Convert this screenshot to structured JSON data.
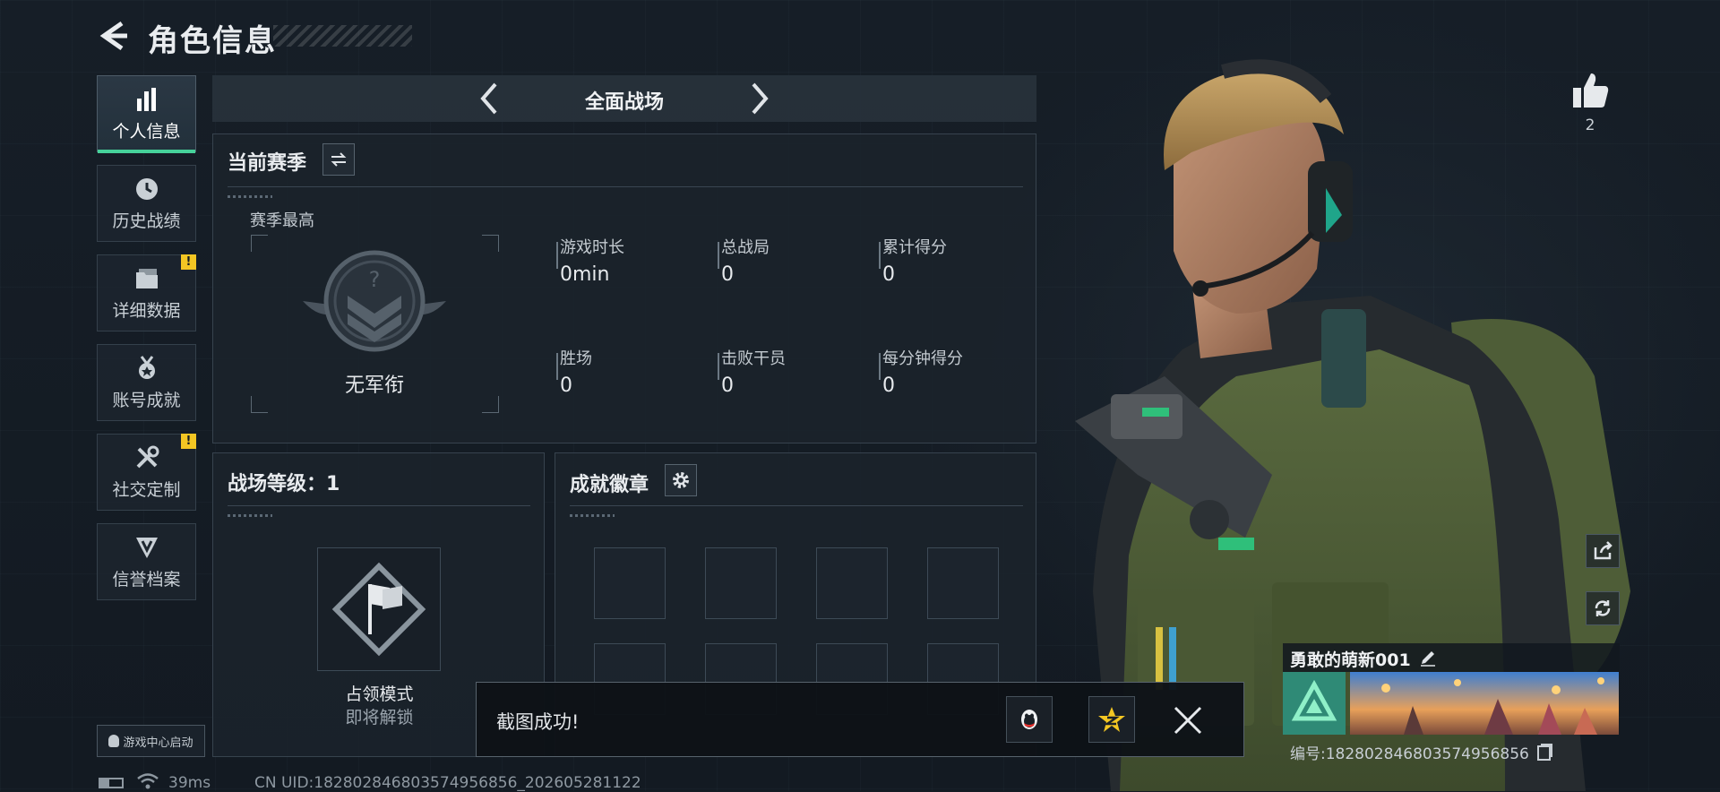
{
  "header": {
    "title": "角色信息"
  },
  "sidebar": {
    "items": [
      {
        "label": "个人信息",
        "icon": "bar-chart-icon",
        "active": true,
        "alert": false
      },
      {
        "label": "历史战绩",
        "icon": "clock-icon",
        "active": false,
        "alert": false
      },
      {
        "label": "详细数据",
        "icon": "folder-icon",
        "active": false,
        "alert": true
      },
      {
        "label": "账号成就",
        "icon": "medal-icon",
        "active": false,
        "alert": false
      },
      {
        "label": "社交定制",
        "icon": "tools-icon",
        "active": false,
        "alert": true
      },
      {
        "label": "信誉档案",
        "icon": "shield-icon",
        "active": false,
        "alert": false
      }
    ],
    "alert_mark": "!",
    "game_center": "游戏中心启动"
  },
  "mode": {
    "label": "全面战场"
  },
  "season": {
    "title": "当前赛季",
    "best_label": "赛季最高",
    "rank_name": "无军衔",
    "rank_placeholder": "?",
    "stats": [
      {
        "label": "游戏时长",
        "value": "0min"
      },
      {
        "label": "总战局",
        "value": "0"
      },
      {
        "label": "累计得分",
        "value": "0"
      },
      {
        "label": "胜场",
        "value": "0"
      },
      {
        "label": "击败干员",
        "value": "0"
      },
      {
        "label": "每分钟得分",
        "value": "0"
      }
    ]
  },
  "battle_level": {
    "title": "战场等级：1",
    "mode_name": "占领模式",
    "mode_status": "即将解锁"
  },
  "badges": {
    "title": "成就徽章"
  },
  "toast": {
    "message": "截图成功!"
  },
  "profile": {
    "likes": "2",
    "name": "勇敢的萌新001",
    "id": "编号:182802846803574956856"
  },
  "status_bar": {
    "ping": "39ms",
    "uid": "CN UID:182802846803574956856_202605281122"
  },
  "colors": {
    "accent": "#46d19a",
    "alert": "#f3c623",
    "rank_box": "#2f8a76"
  }
}
